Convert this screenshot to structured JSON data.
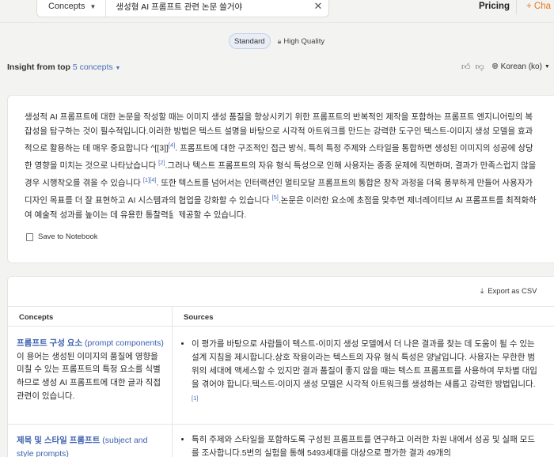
{
  "search": {
    "scope": "Concepts",
    "query": "생성형 AI 프롬프트 관련 논문 쓸거야",
    "clear_icon": "close-icon"
  },
  "header": {
    "pricing": "Pricing",
    "chat": "+ Cha"
  },
  "modes": {
    "standard": "Standard",
    "high_quality": "High Quality"
  },
  "insight": {
    "label": "Insight from top ",
    "count": "5 concepts",
    "language": "Korean (ko)"
  },
  "summary": {
    "segments": [
      "생성적 AI 프롬프트에 대한 논문을 작성할 때는 이미지 생성 품질을 향상시키기 위한 프롬프트의 반복적인 제작을 포함하는 프롬프트 엔지니어링의 복잡성을 탐구하는 것이 필수적입니다.이러한 방법은 텍스트 설명을 바탕으로 시각적 아트워크를 만드는 강력한 도구인 텍스트-이미지 생성 모델을 효과적으로 활용하는 데 매우 중요합니다 ^[[3]]",
      ". 프롬프트에 대한 구조적인 접근 방식, 특히 특정 주제와 스타일을 통합하면 생성된 이미지의 성공에 상당한 영향을 미치는 것으로 나타났습니다 ",
      ".그러나 텍스트 프롬프트의 자유 형식 특성으로 인해 사용자는 종종 문제에 직면하며, 결과가 만족스럽지 않을 경우 시행착오를 겪을 수 있습니다 ",
      ". 또한 텍스트를 넘어서는 인터랙션인 멀티모달 프롬프트의 통합은 창작 과정을 더욱 풍부하게 만들어 사용자가 디자인 목표를 더 잘 표현하고 AI 시스템과의 협업을 강화할 수 있습니다 ",
      ".논문은 이러한 요소에 초점을 맞추면 제너레이티브 AI 프롬프트를 최적화하여 예술적 성과를 높이는 데 유용한 통찰력을 제공할 수 있습니다."
    ],
    "citations": [
      "[4]",
      "[2]",
      "[1][4]",
      "[5]"
    ],
    "save_label": "Save to Notebook"
  },
  "table": {
    "export_label": "Export as CSV",
    "headers": [
      "Concepts",
      "Sources"
    ],
    "rows": [
      {
        "concept_title": "프롬프트 구성 요소",
        "concept_en": " (prompt components)",
        "concept_desc": "이 용어는 생성된 이미지의 품질에 영향을 미칠 수 있는 프롬프트의 특정 요소를 식별하므로 생성 AI 프롬프트에 대한 글과 직접 관련이 있습니다.",
        "source_text": "이 평가를 바탕으로 사람들이 텍스트-이미지 생성 모델에서 더 나은 결과를 찾는 데 도움이 될 수 있는 설계 지침을 제시합니다.상호 작용이라는 텍스트의 자유 형식 특성은 양날입니다. 사용자는 무한한 범위의 세대에 액세스할 수 있지만 결과 품질이 좋지 않을 때는 텍스트 프롬프트를 사용하여 무차별 대입을 겪어야 합니다.텍스트-이미지 생성 모델은 시각적 아트워크를 생성하는 새롭고 강력한 방법입니다.",
        "source_cite": "[1]"
      },
      {
        "concept_title": "제목 및 스타일 프롬프트",
        "concept_en": " (subject and style prompts)",
        "source_text": "특히 주제와 스타일을 포함하도록 구성된 프롬프트를 연구하고 이러한 차원 내에서 성공 및 실패 모드를 조사합니다.5번의 실험을 통해 5493세대를 대상으로 평가한 결과 49개의"
      }
    ]
  }
}
